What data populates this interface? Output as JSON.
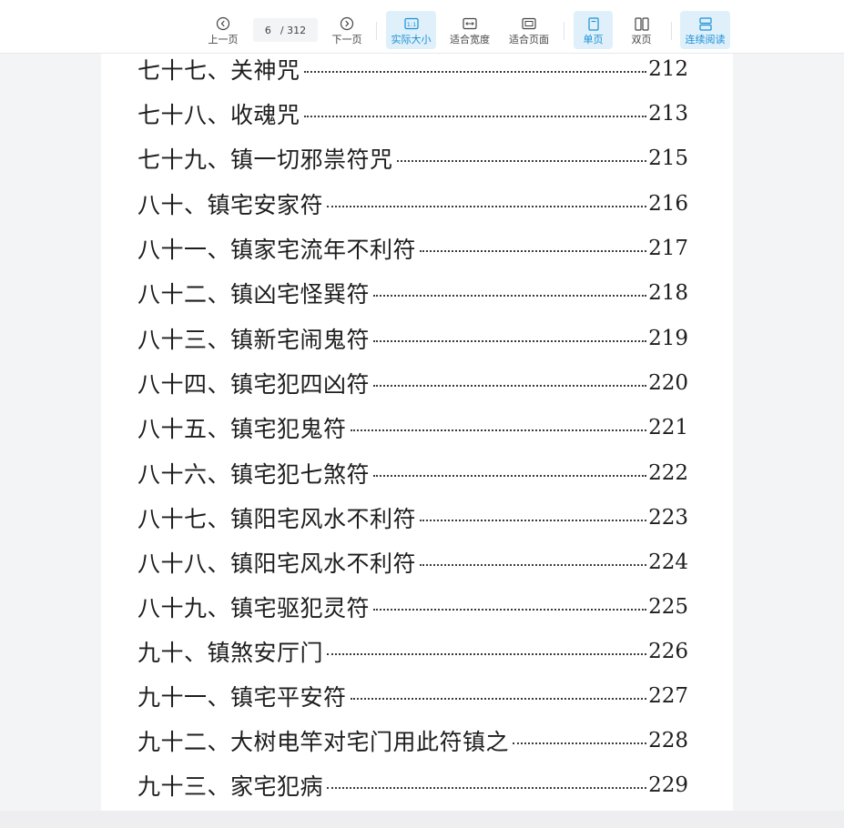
{
  "toolbar": {
    "prev_label": "上一页",
    "next_label": "下一页",
    "page_current": "6",
    "page_total": "/ 312",
    "actual_size_label": "实际大小",
    "fit_width_label": "适合宽度",
    "fit_page_label": "适合页面",
    "single_page_label": "单页",
    "double_page_label": "双页",
    "continuous_label": "连续阅读",
    "accent_color": "#1a8fd6"
  },
  "toc": [
    {
      "title": "七十七、关神咒",
      "page": "212"
    },
    {
      "title": "七十八、收魂咒",
      "page": "213"
    },
    {
      "title": "七十九、镇一切邪祟符咒",
      "page": "215"
    },
    {
      "title": "八十、镇宅安家符",
      "page": "216"
    },
    {
      "title": "八十一、镇家宅流年不利符",
      "page": "217"
    },
    {
      "title": "八十二、镇凶宅怪巽符",
      "page": "218"
    },
    {
      "title": "八十三、镇新宅闹鬼符",
      "page": "219"
    },
    {
      "title": "八十四、镇宅犯四凶符",
      "page": "220"
    },
    {
      "title": "八十五、镇宅犯鬼符",
      "page": "221"
    },
    {
      "title": "八十六、镇宅犯七煞符",
      "page": "222"
    },
    {
      "title": "八十七、镇阳宅风水不利符",
      "page": "223"
    },
    {
      "title": "八十八、镇阳宅风水不利符",
      "page": "224"
    },
    {
      "title": "八十九、镇宅驱犯灵符",
      "page": "225"
    },
    {
      "title": "九十、镇煞安厅门",
      "page": "226"
    },
    {
      "title": "九十一、镇宅平安符",
      "page": "227"
    },
    {
      "title": "九十二、大树电竿对宅门用此符镇之",
      "page": "228"
    },
    {
      "title": "九十三、家宅犯病",
      "page": "229"
    }
  ]
}
